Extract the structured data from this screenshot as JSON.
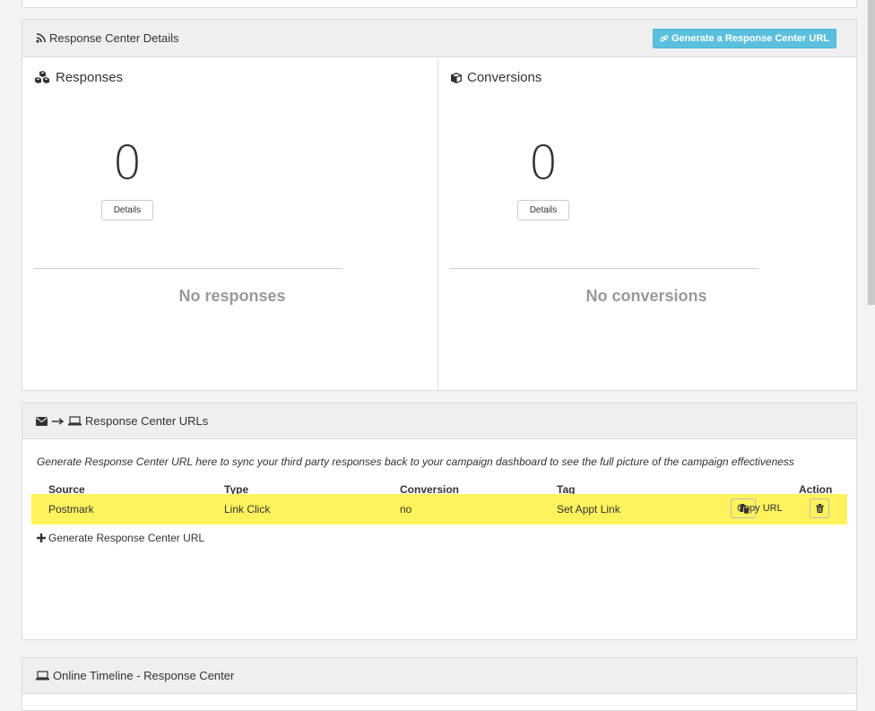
{
  "details_panel": {
    "title": "Response Center Details",
    "generate_button": "Generate a Response Center URL",
    "responses": {
      "title": "Responses",
      "count": "0",
      "details_button": "Details",
      "empty": "No responses"
    },
    "conversions": {
      "title": "Conversions",
      "count": "0",
      "details_button": "Details",
      "empty": "No conversions"
    }
  },
  "urls_panel": {
    "title": "Response Center URLs",
    "intro": "Generate Response Center URL here to sync your third party responses back to your campaign dashboard to see the full picture of the campaign effectiveness",
    "columns": [
      "Source",
      "Type",
      "Conversion",
      "Tag",
      "Action"
    ],
    "rows": [
      {
        "source": "Postmark",
        "type": "Link Click",
        "conversion": "no",
        "tag": "Set Appt Link",
        "copy_label": "Copy URL"
      }
    ],
    "generate_link": "Generate Response Center URL"
  },
  "timeline_panel": {
    "title": "Online Timeline - Response Center"
  },
  "colors": {
    "info_button": "#5bc0de",
    "highlight_row": "#fff35c",
    "panel_heading": "#efefef"
  },
  "icons": [
    "rss-icon",
    "link-icon",
    "cubes-icon",
    "cube-icon",
    "envelope-icon",
    "arrow-right-icon",
    "laptop-icon",
    "paste-icon",
    "trash-icon",
    "plus-icon"
  ]
}
